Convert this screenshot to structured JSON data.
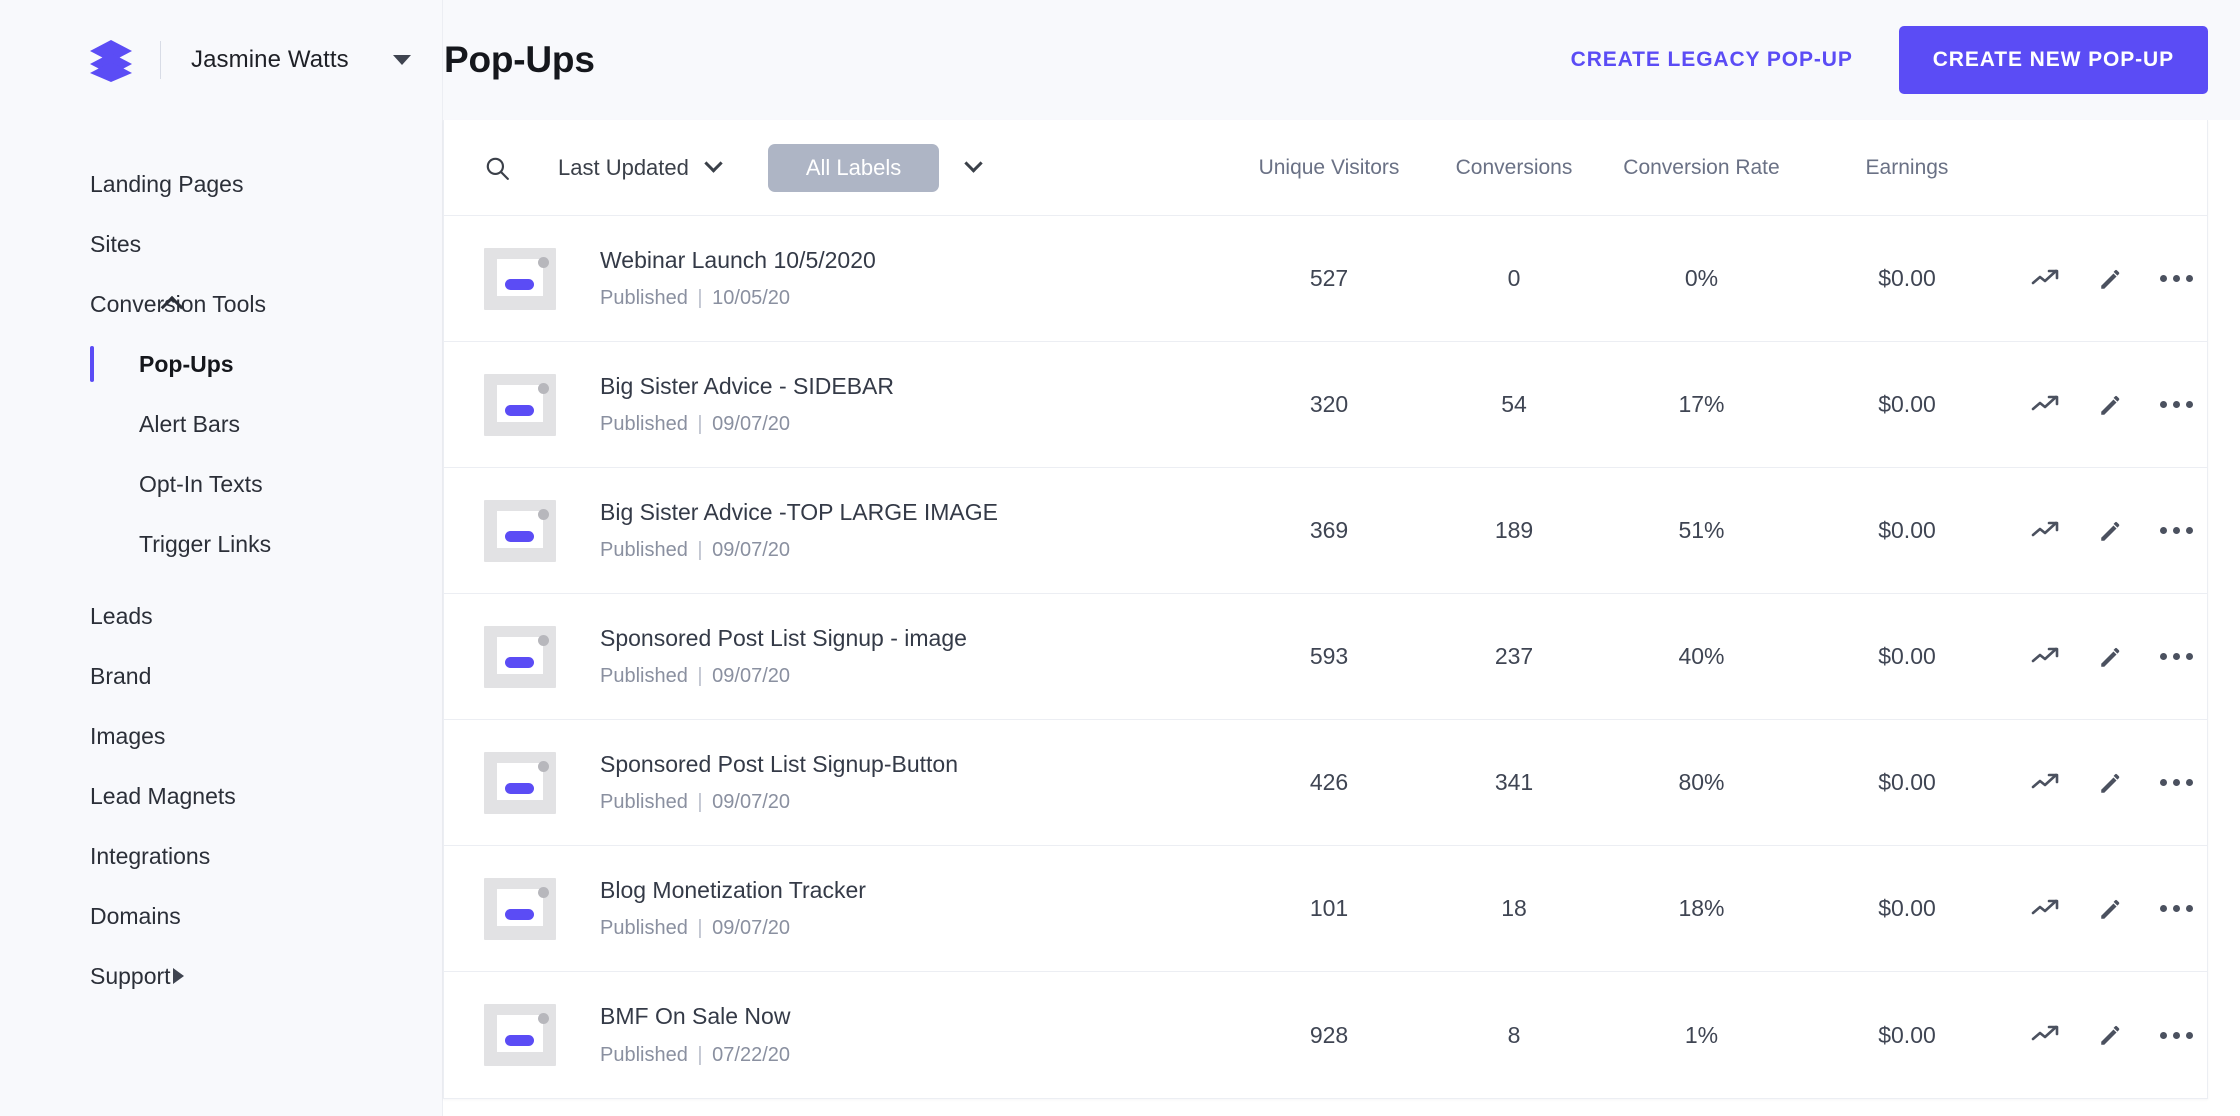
{
  "brand": {
    "logo_icon": "layers-stack-icon",
    "account_name": "Jasmine Watts",
    "caret_icon": "caret-down-icon"
  },
  "sidebar": {
    "items": [
      {
        "label": "Landing Pages",
        "level": "top",
        "icon": null
      },
      {
        "label": "Sites",
        "level": "top",
        "icon": null
      },
      {
        "label": "Conversion Tools",
        "level": "top",
        "icon": "chevron-up-icon"
      },
      {
        "label": "Pop-Ups",
        "level": "sub",
        "active": true
      },
      {
        "label": "Alert Bars",
        "level": "sub"
      },
      {
        "label": "Opt-In Texts",
        "level": "sub"
      },
      {
        "label": "Trigger Links",
        "level": "sub"
      },
      {
        "label": "Leads",
        "level": "top"
      },
      {
        "label": "Brand",
        "level": "top"
      },
      {
        "label": "Images",
        "level": "top"
      },
      {
        "label": "Lead Magnets",
        "level": "top"
      },
      {
        "label": "Integrations",
        "level": "top"
      },
      {
        "label": "Domains",
        "level": "top"
      },
      {
        "label": "Support",
        "level": "top",
        "icon": "triangle-right-icon"
      }
    ]
  },
  "header": {
    "title": "Pop-Ups",
    "legacy_button": "CREATE LEGACY POP-UP",
    "new_button": "CREATE NEW POP-UP"
  },
  "toolbar": {
    "search_icon": "search-icon",
    "sort_label": "Last Updated",
    "sort_caret": "chevron-down-icon",
    "labels_pill": "All Labels",
    "labels_caret": "chevron-down-icon"
  },
  "table": {
    "columns": {
      "visitors": "Unique Visitors",
      "conversions": "Conversions",
      "rate": "Conversion Rate",
      "earnings": "Earnings"
    },
    "row_actions": {
      "stats": "trending-up-icon",
      "edit": "pencil-icon",
      "more": "ellipsis-icon"
    },
    "rows": [
      {
        "title": "Webinar Launch 10/5/2020",
        "status": "Published",
        "date": "10/05/20",
        "visitors": "527",
        "conversions": "0",
        "rate": "0%",
        "earnings": "$0.00"
      },
      {
        "title": "Big Sister Advice - SIDEBAR",
        "status": "Published",
        "date": "09/07/20",
        "visitors": "320",
        "conversions": "54",
        "rate": "17%",
        "earnings": "$0.00"
      },
      {
        "title": "Big Sister Advice -TOP LARGE IMAGE",
        "status": "Published",
        "date": "09/07/20",
        "visitors": "369",
        "conversions": "189",
        "rate": "51%",
        "earnings": "$0.00"
      },
      {
        "title": "Sponsored Post List Signup - image",
        "status": "Published",
        "date": "09/07/20",
        "visitors": "593",
        "conversions": "237",
        "rate": "40%",
        "earnings": "$0.00"
      },
      {
        "title": "Sponsored Post List Signup-Button",
        "status": "Published",
        "date": "09/07/20",
        "visitors": "426",
        "conversions": "341",
        "rate": "80%",
        "earnings": "$0.00"
      },
      {
        "title": "Blog Monetization Tracker",
        "status": "Published",
        "date": "09/07/20",
        "visitors": "101",
        "conversions": "18",
        "rate": "18%",
        "earnings": "$0.00"
      },
      {
        "title": "BMF On Sale Now",
        "status": "Published",
        "date": "07/22/20",
        "visitors": "928",
        "conversions": "8",
        "rate": "1%",
        "earnings": "$0.00"
      }
    ],
    "meta_separator": "|"
  },
  "colors": {
    "accent": "#5B4CF5",
    "sidebar_bg": "#F8F9FC",
    "pill_bg": "#AEB5C5",
    "text_primary": "#2B2F38",
    "text_muted": "#8A90A0"
  }
}
